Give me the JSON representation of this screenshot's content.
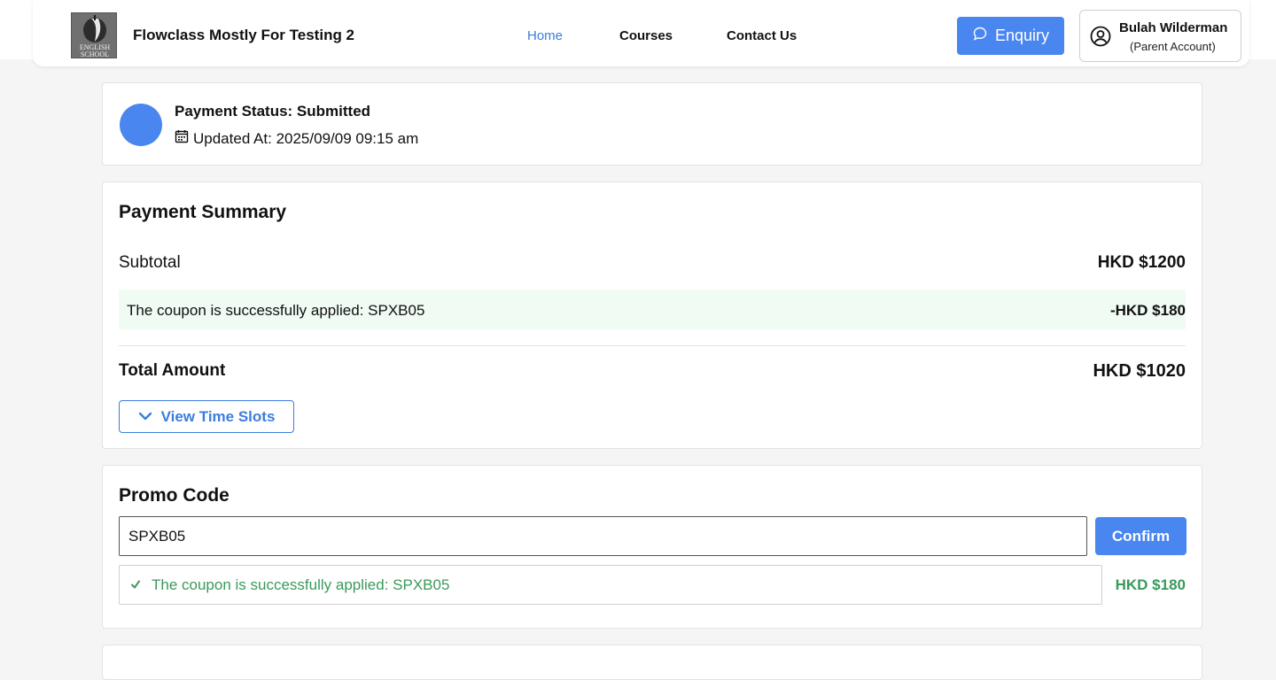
{
  "header": {
    "site_title": "Flowclass Mostly For Testing 2",
    "logo_text_line1": "ENGLISH",
    "logo_text_line2": "SCHOOL",
    "nav": {
      "home": "Home",
      "courses": "Courses",
      "contact": "Contact Us"
    },
    "enquiry_label": "Enquiry",
    "account_name": "Bulah Wilderman",
    "account_type": "(Parent Account)"
  },
  "status": {
    "title": "Payment Status: Submitted",
    "updated": "Updated At: 2025/09/09 09:15 am"
  },
  "summary": {
    "heading": "Payment Summary",
    "subtotal_label": "Subtotal",
    "subtotal_value": "HKD $1200",
    "coupon_label": "The coupon is successfully applied: SPXB05",
    "coupon_value": "-HKD $180",
    "total_label": "Total Amount",
    "total_value": "HKD $1020",
    "view_slots_label": "View Time Slots"
  },
  "promo": {
    "heading": "Promo Code",
    "input_value": "SPXB05",
    "confirm_label": "Confirm",
    "applied_message": "The coupon is successfully applied: SPXB05",
    "applied_amount": "HKD $180"
  },
  "colors": {
    "accent": "#4a86f0",
    "success": "#3a9a5b",
    "coupon_bg": "#effbf3"
  }
}
